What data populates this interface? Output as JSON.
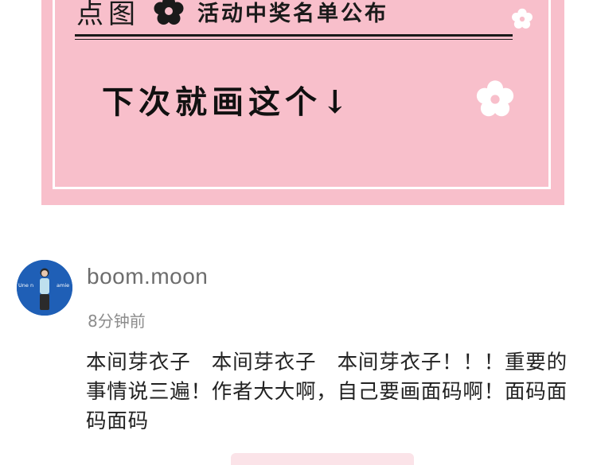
{
  "banner": {
    "prefix": "点图",
    "title": "活动中奖名单公布",
    "subtitle": "下次就画这个↓",
    "flower_icon": "flower-icon",
    "colors": {
      "background": "#f8bfcb",
      "frame": "#ffffff",
      "ink": "#1a1a1a"
    }
  },
  "comment": {
    "avatar_icon": "user-avatar",
    "avatar_text": "Une n... amie",
    "username": "boom.moon",
    "timestamp": "8分钟前",
    "body": "本间芽衣子　本间芽衣子　本间芽衣子！！！重要的事情说三遍！作者大大啊，自己要画面码啊！面码面码面码"
  }
}
